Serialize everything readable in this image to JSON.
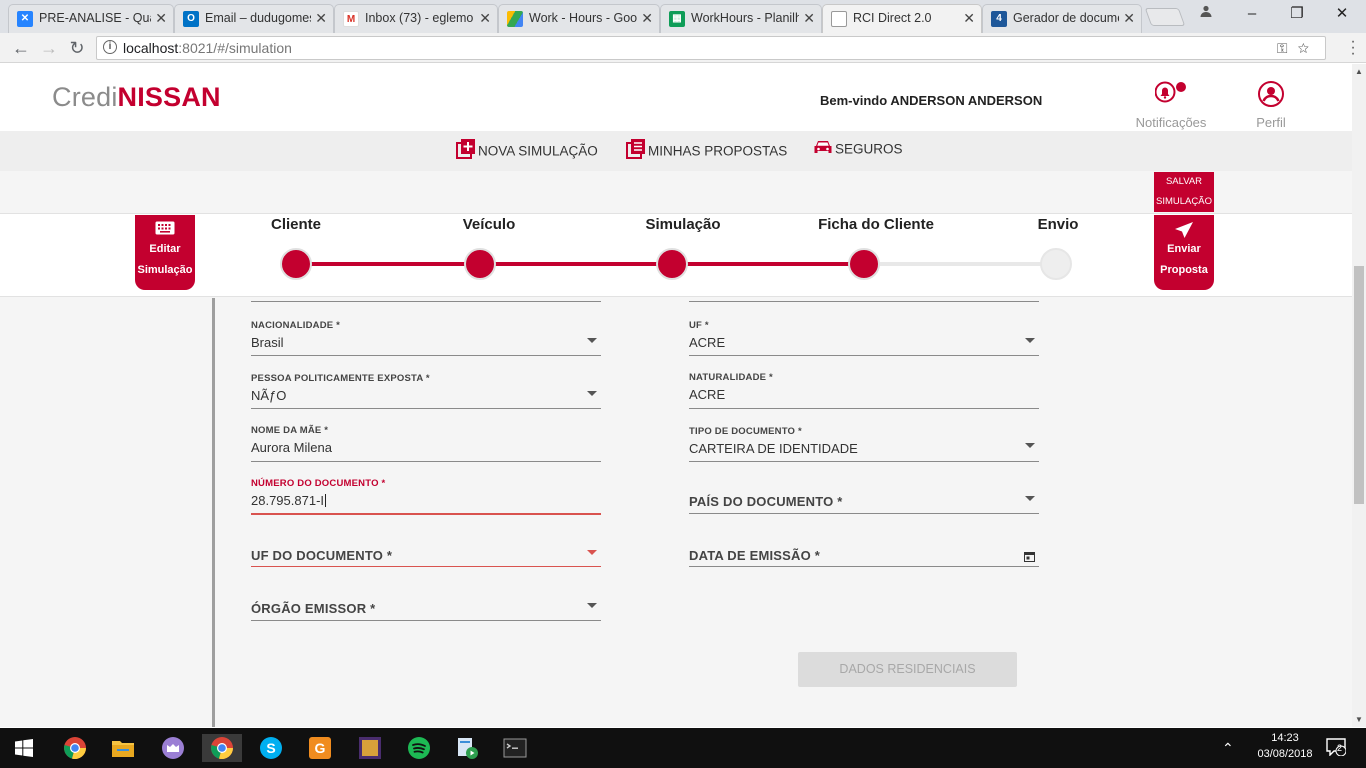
{
  "browser": {
    "tabs": [
      {
        "title": "PRE-ANALISE - Qua",
        "favicon": "jira-icon",
        "color": "#2684ff"
      },
      {
        "title": "Email – dudugomes",
        "favicon": "outlook-icon",
        "color": "#0072c6"
      },
      {
        "title": "Inbox (73) - eglemo",
        "favicon": "gmail-icon",
        "color": "#d93025"
      },
      {
        "title": "Work - Hours - Goo",
        "favicon": "drive-icon",
        "color": "#34a853"
      },
      {
        "title": "WorkHours - Planilh",
        "favicon": "sheets-icon",
        "color": "#0f9d58"
      },
      {
        "title": "RCI Direct 2.0",
        "favicon": "page-icon",
        "color": "#888888"
      },
      {
        "title": "Gerador de docume",
        "favicon": "4devs-icon",
        "color": "#1e5799"
      }
    ],
    "url_host": "localhost",
    "url_path": ":8021/#/simulation"
  },
  "header": {
    "logo_part1": "Credi",
    "logo_part2": "NISSAN",
    "welcome_prefix": "Bem-vindo ",
    "welcome_name": "ANDERSON ANDERSON",
    "notifications_label": "Notificações",
    "profile_label": "Perfil"
  },
  "nav": {
    "new_simulation": "NOVA SIMULAÇÃO",
    "my_proposals": "MINHAS PROPOSTAS",
    "insurance": "SEGUROS"
  },
  "actions": {
    "save_line1": "SALVAR",
    "save_line2": "SIMULAÇÃO",
    "edit_line1": "Editar",
    "edit_line2": "Simulação",
    "send_line1": "Enviar",
    "send_line2": "Proposta"
  },
  "steps": [
    {
      "label": "Cliente",
      "done": true
    },
    {
      "label": "Veículo",
      "done": true
    },
    {
      "label": "Simulação",
      "done": true
    },
    {
      "label": "Ficha do Cliente",
      "done": true
    },
    {
      "label": "Envio",
      "done": false
    }
  ],
  "form": {
    "nationality": {
      "label": "NACIONALIDADE *",
      "value": "Brasil"
    },
    "uf": {
      "label": "UF *",
      "value": "ACRE"
    },
    "pep": {
      "label": "PESSOA POLITICAMENTE EXPOSTA *",
      "value": "NÃƒO"
    },
    "birthplace": {
      "label": "NATURALIDADE *",
      "value": "ACRE"
    },
    "mother_name": {
      "label": "NOME DA MÃE *",
      "value": "Aurora Milena"
    },
    "doc_type": {
      "label": "TIPO DE DOCUMENTO *",
      "value": "CARTEIRA DE IDENTIDADE"
    },
    "doc_number": {
      "label": "NÚMERO DO DOCUMENTO *",
      "value": "28.795.871-I"
    },
    "doc_country": {
      "label": "PAÍS DO DOCUMENTO *"
    },
    "doc_uf": {
      "label": "UF DO DOCUMENTO *"
    },
    "issue_date": {
      "label": "DATA DE EMISSÃO *"
    },
    "issuer": {
      "label": "ÓRGÃO EMISSOR *"
    },
    "next_button": "DADOS RESIDENCIAIS"
  },
  "taskbar": {
    "time": "14:23",
    "date": "03/08/2018",
    "notifications_count": "2"
  },
  "colors": {
    "brand": "#c3002f",
    "step_inactive": "#e8e8e8"
  }
}
